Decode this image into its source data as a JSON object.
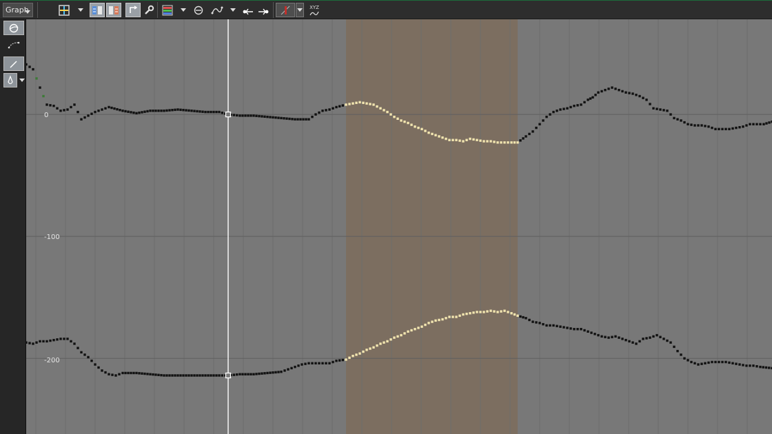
{
  "toolbar": {
    "mode_label": "Graph",
    "xyz_label": "XYZ",
    "icons": [
      "frame-view-icon",
      "dropdown",
      "copy-keys-icon",
      "paste-keys-icon",
      "swap-icon",
      "wrench-icon",
      "color-channels-icon",
      "dropdown",
      "normalize-icon",
      "curve-fit-icon",
      "dropdown",
      "step-back-icon",
      "step-forward-icon",
      "red-marker-icon",
      "dropdown",
      "xyz-axes-icon"
    ]
  },
  "leftbar": {
    "icons": [
      "graph-mode-icon",
      "curve-tool-icon",
      "pen-tool-icon",
      "ink-tool-icon"
    ]
  },
  "graph": {
    "y_labels": [
      "0",
      "-100",
      "-200"
    ],
    "colors": {
      "background": "#787878",
      "selection": "#7c6e60",
      "key_normal": "#111111",
      "key_selected": "#f2e5b0",
      "key_green": "#3d7a37",
      "cursor": "#ffffff",
      "grid": "#6d6d6d"
    }
  },
  "chart_data": {
    "type": "scatter",
    "y_ticks": [
      0,
      -100,
      -200
    ],
    "ylim": [
      -262,
      78
    ],
    "xlim": [
      0,
      1082
    ],
    "selection_range": [
      464,
      713
    ],
    "cursor_x": 293,
    "grid": true,
    "series": [
      {
        "points": [
          [
            0,
            41
          ],
          [
            10,
            37
          ],
          [
            20,
            22
          ],
          [
            30,
            8
          ],
          [
            40,
            7
          ],
          [
            50,
            3
          ],
          [
            60,
            4
          ],
          [
            70,
            8
          ],
          [
            80,
            -4
          ],
          [
            90,
            -1
          ],
          [
            100,
            2
          ],
          [
            110,
            4
          ],
          [
            120,
            6
          ],
          [
            140,
            3
          ],
          [
            160,
            1
          ],
          [
            180,
            3
          ],
          [
            200,
            3
          ],
          [
            220,
            4
          ],
          [
            240,
            3
          ],
          [
            260,
            2
          ],
          [
            280,
            2
          ],
          [
            293,
            0
          ],
          [
            310,
            -1
          ],
          [
            330,
            -1
          ],
          [
            350,
            -2
          ],
          [
            370,
            -3
          ],
          [
            390,
            -4
          ],
          [
            410,
            -4
          ],
          [
            420,
            0
          ],
          [
            430,
            3
          ],
          [
            440,
            4
          ],
          [
            450,
            6
          ],
          [
            464,
            8
          ],
          [
            474,
            9
          ],
          [
            484,
            10
          ],
          [
            494,
            9
          ],
          [
            504,
            8
          ],
          [
            514,
            5
          ],
          [
            524,
            2
          ],
          [
            534,
            -2
          ],
          [
            544,
            -5
          ],
          [
            554,
            -7
          ],
          [
            564,
            -10
          ],
          [
            574,
            -12
          ],
          [
            584,
            -15
          ],
          [
            594,
            -17
          ],
          [
            604,
            -19
          ],
          [
            614,
            -21
          ],
          [
            624,
            -21
          ],
          [
            634,
            -22
          ],
          [
            644,
            -20
          ],
          [
            654,
            -21
          ],
          [
            664,
            -22
          ],
          [
            674,
            -22
          ],
          [
            684,
            -23
          ],
          [
            694,
            -23
          ],
          [
            704,
            -23
          ],
          [
            713,
            -23
          ],
          [
            725,
            -18
          ],
          [
            735,
            -14
          ],
          [
            745,
            -8
          ],
          [
            755,
            -2
          ],
          [
            765,
            2
          ],
          [
            775,
            4
          ],
          [
            785,
            5
          ],
          [
            795,
            7
          ],
          [
            805,
            8
          ],
          [
            815,
            12
          ],
          [
            822,
            14
          ],
          [
            830,
            18
          ],
          [
            840,
            20
          ],
          [
            850,
            22
          ],
          [
            860,
            20
          ],
          [
            870,
            18
          ],
          [
            880,
            17
          ],
          [
            890,
            15
          ],
          [
            900,
            12
          ],
          [
            910,
            5
          ],
          [
            920,
            4
          ],
          [
            930,
            3
          ],
          [
            940,
            -3
          ],
          [
            950,
            -5
          ],
          [
            960,
            -8
          ],
          [
            970,
            -9
          ],
          [
            980,
            -9
          ],
          [
            990,
            -10
          ],
          [
            1000,
            -12
          ],
          [
            1010,
            -12
          ],
          [
            1020,
            -12
          ],
          [
            1030,
            -11
          ],
          [
            1040,
            -10
          ],
          [
            1050,
            -8
          ],
          [
            1060,
            -8
          ],
          [
            1070,
            -8
          ],
          [
            1082,
            -6
          ]
        ]
      },
      {
        "points": [
          [
            0,
            -187
          ],
          [
            10,
            -188
          ],
          [
            20,
            -186
          ],
          [
            30,
            -186
          ],
          [
            40,
            -185
          ],
          [
            50,
            -184
          ],
          [
            60,
            -184
          ],
          [
            70,
            -188
          ],
          [
            80,
            -195
          ],
          [
            90,
            -199
          ],
          [
            100,
            -205
          ],
          [
            110,
            -210
          ],
          [
            120,
            -213
          ],
          [
            130,
            -214
          ],
          [
            140,
            -212
          ],
          [
            160,
            -212
          ],
          [
            180,
            -213
          ],
          [
            200,
            -214
          ],
          [
            220,
            -214
          ],
          [
            240,
            -214
          ],
          [
            260,
            -214
          ],
          [
            280,
            -214
          ],
          [
            293,
            -214
          ],
          [
            310,
            -213
          ],
          [
            330,
            -213
          ],
          [
            350,
            -212
          ],
          [
            370,
            -211
          ],
          [
            380,
            -209
          ],
          [
            390,
            -207
          ],
          [
            400,
            -205
          ],
          [
            410,
            -204
          ],
          [
            420,
            -204
          ],
          [
            430,
            -204
          ],
          [
            440,
            -204
          ],
          [
            450,
            -202
          ],
          [
            464,
            -201
          ],
          [
            474,
            -198
          ],
          [
            484,
            -196
          ],
          [
            494,
            -193
          ],
          [
            504,
            -191
          ],
          [
            514,
            -188
          ],
          [
            524,
            -186
          ],
          [
            534,
            -183
          ],
          [
            544,
            -181
          ],
          [
            554,
            -178
          ],
          [
            564,
            -176
          ],
          [
            574,
            -174
          ],
          [
            584,
            -171
          ],
          [
            594,
            -169
          ],
          [
            604,
            -168
          ],
          [
            614,
            -166
          ],
          [
            624,
            -166
          ],
          [
            634,
            -164
          ],
          [
            644,
            -163
          ],
          [
            654,
            -162
          ],
          [
            664,
            -162
          ],
          [
            674,
            -161
          ],
          [
            684,
            -162
          ],
          [
            694,
            -161
          ],
          [
            704,
            -163
          ],
          [
            713,
            -165
          ],
          [
            725,
            -167
          ],
          [
            735,
            -170
          ],
          [
            745,
            -171
          ],
          [
            755,
            -173
          ],
          [
            765,
            -173
          ],
          [
            775,
            -174
          ],
          [
            785,
            -175
          ],
          [
            795,
            -176
          ],
          [
            805,
            -176
          ],
          [
            815,
            -178
          ],
          [
            825,
            -180
          ],
          [
            835,
            -182
          ],
          [
            845,
            -183
          ],
          [
            855,
            -182
          ],
          [
            865,
            -184
          ],
          [
            875,
            -186
          ],
          [
            885,
            -188
          ],
          [
            895,
            -184
          ],
          [
            905,
            -183
          ],
          [
            915,
            -181
          ],
          [
            925,
            -184
          ],
          [
            935,
            -187
          ],
          [
            945,
            -194
          ],
          [
            955,
            -200
          ],
          [
            965,
            -203
          ],
          [
            975,
            -205
          ],
          [
            985,
            -204
          ],
          [
            995,
            -203
          ],
          [
            1005,
            -203
          ],
          [
            1015,
            -203
          ],
          [
            1025,
            -204
          ],
          [
            1035,
            -205
          ],
          [
            1045,
            -206
          ],
          [
            1055,
            -206
          ],
          [
            1065,
            -207
          ],
          [
            1082,
            -208
          ]
        ]
      }
    ]
  }
}
